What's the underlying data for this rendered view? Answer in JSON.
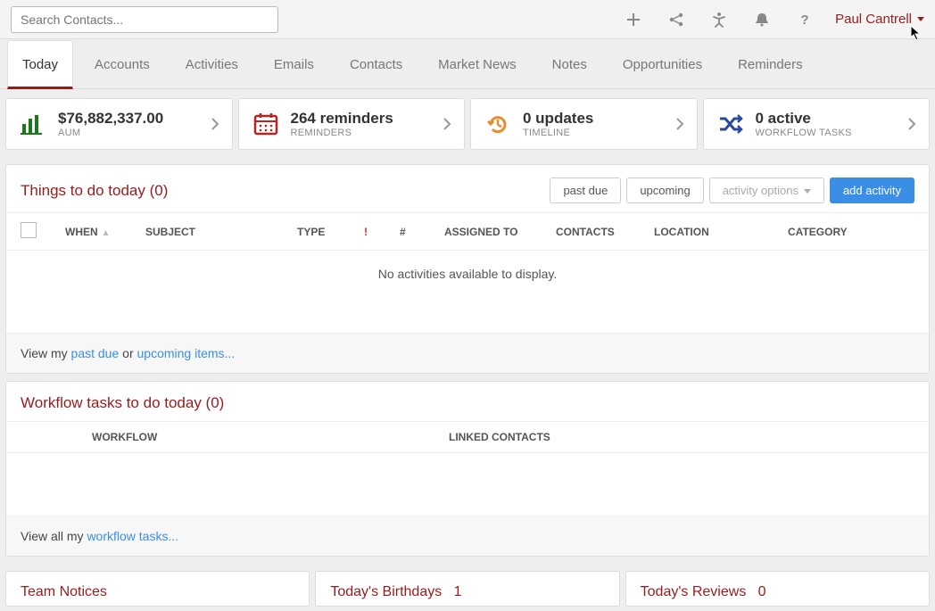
{
  "header": {
    "search_placeholder": "Search Contacts...",
    "user_name": "Paul Cantrell"
  },
  "tabs": [
    {
      "label": "Today",
      "active": true
    },
    {
      "label": "Accounts"
    },
    {
      "label": "Activities"
    },
    {
      "label": "Emails"
    },
    {
      "label": "Contacts"
    },
    {
      "label": "Market News"
    },
    {
      "label": "Notes"
    },
    {
      "label": "Opportunities"
    },
    {
      "label": "Reminders"
    }
  ],
  "summary_cards": {
    "aum": {
      "title": "$76,882,337.00",
      "sub": "AUM"
    },
    "reminders": {
      "title": "264 reminders",
      "sub": "REMINDERS"
    },
    "updates": {
      "title": "0 updates",
      "sub": "TIMELINE"
    },
    "workflow": {
      "title": "0 active",
      "sub": "WORKFLOW TASKS"
    }
  },
  "things": {
    "title": "Things to do today (0)",
    "btn_past_due": "past due",
    "btn_upcoming": "upcoming",
    "btn_options": "activity options",
    "btn_add": "add activity",
    "cols": {
      "when": "WHEN",
      "subject": "SUBJECT",
      "type": "TYPE",
      "bang": "!",
      "hash": "#",
      "assigned": "ASSIGNED TO",
      "contacts": "CONTACTS",
      "location": "LOCATION",
      "category": "CATEGORY"
    },
    "empty": "No activities available to display.",
    "footer_prefix": "View my ",
    "footer_link1": "past due",
    "footer_mid": " or ",
    "footer_link2": "upcoming items..."
  },
  "workflow_panel": {
    "title": "Workflow tasks to do today (0)",
    "cols": {
      "workflow": "WORKFLOW",
      "linked": "LINKED CONTACTS"
    },
    "footer_prefix": "View all my ",
    "footer_link": "workflow tasks..."
  },
  "bottom": {
    "notices": "Team Notices",
    "birthdays_label": "Today's Birthdays",
    "birthdays_count": "1",
    "reviews_label": "Today's Reviews",
    "reviews_count": "0"
  }
}
